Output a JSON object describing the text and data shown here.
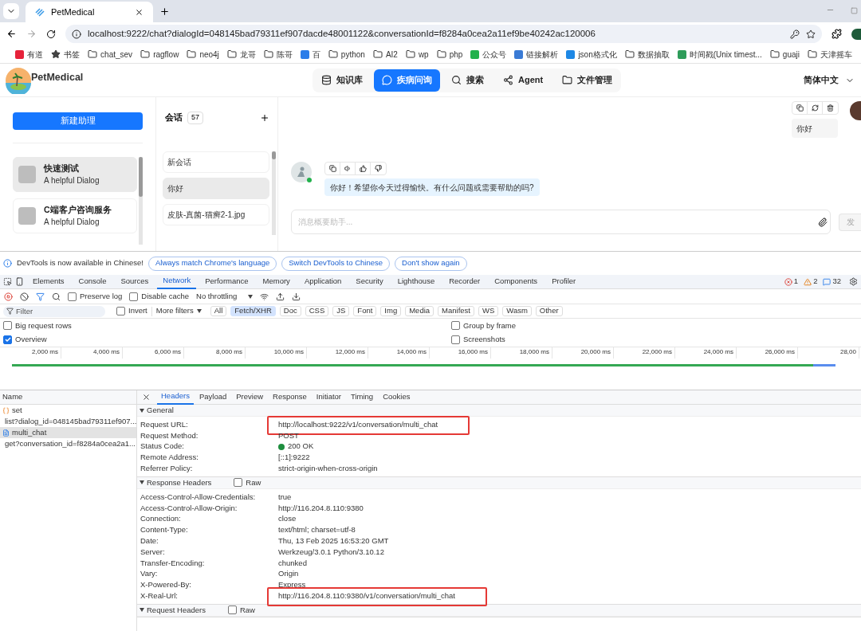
{
  "browser": {
    "tabs": [
      {
        "title": "PetMedical",
        "selected": true
      }
    ],
    "address": "localhost:9222/chat?dialogId=048145bad79311ef907dacde48001122&conversationId=f8284a0cea2a11ef9be40242ac120006",
    "bookmarks": [
      {
        "label": "有道",
        "kind": "app",
        "color": "#e6223a"
      },
      {
        "label": "书签",
        "kind": "star"
      },
      {
        "label": "chat_sev",
        "kind": "folder"
      },
      {
        "label": "ragflow",
        "kind": "folder"
      },
      {
        "label": "neo4j",
        "kind": "folder"
      },
      {
        "label": "龙哥",
        "kind": "folder"
      },
      {
        "label": "陈哥",
        "kind": "folder"
      },
      {
        "label": "百",
        "kind": "app",
        "color": "#2b7de9"
      },
      {
        "label": "python",
        "kind": "folder"
      },
      {
        "label": "AI2",
        "kind": "folder"
      },
      {
        "label": "wp",
        "kind": "folder"
      },
      {
        "label": "php",
        "kind": "folder"
      },
      {
        "label": "公众号",
        "kind": "app",
        "color": "#22b14c"
      },
      {
        "label": "链接解析",
        "kind": "app",
        "color": "#3a7bd5"
      },
      {
        "label": "json格式化",
        "kind": "app",
        "color": "#1e88e5"
      },
      {
        "label": "数据抽取",
        "kind": "folder"
      },
      {
        "label": "时间戳(Unix timest...",
        "kind": "app",
        "color": "#2e9c5a"
      },
      {
        "label": "guaji",
        "kind": "folder"
      },
      {
        "label": "天津摇车",
        "kind": "folder"
      }
    ]
  },
  "app": {
    "brand": "PetMedical",
    "nav": [
      {
        "label": "知识库",
        "kind": "database",
        "selected": false
      },
      {
        "label": "疾病问询",
        "kind": "chat",
        "selected": true
      },
      {
        "label": "搜索",
        "kind": "search",
        "selected": false
      },
      {
        "label": "Agent",
        "kind": "graph",
        "selected": false
      },
      {
        "label": "文件管理",
        "kind": "folder",
        "selected": false
      }
    ],
    "language": "简体中文",
    "new_assistant": "新建助理",
    "assistants": [
      {
        "name": "快速测试",
        "description": "A helpful Dialog",
        "selected": true
      },
      {
        "name": "C端客户咨询服务",
        "description": "A helpful Dialog",
        "selected": false
      }
    ],
    "conversations": {
      "title": "会话",
      "count": "57",
      "items": [
        {
          "title": "新会话",
          "selected": false
        },
        {
          "title": "你好",
          "selected": true
        },
        {
          "title": "皮肤-真菌-猫癣2-1.jpg",
          "selected": false
        }
      ]
    },
    "messages": [
      {
        "kind": "user",
        "text": "你好"
      },
      {
        "kind": "assistant",
        "text": "你好！希望你今天过得愉快。有什么问题或需要帮助的吗?"
      }
    ],
    "input_placeholder": "消息概要助手...",
    "send": "发"
  },
  "devtools": {
    "notice": "DevTools is now available in Chinese!",
    "notice_buttons": [
      "Always match Chrome's language",
      "Switch DevTools to Chinese",
      "Don't show again"
    ],
    "panels": [
      {
        "label": "Elements",
        "selected": false
      },
      {
        "label": "Console",
        "selected": false
      },
      {
        "label": "Sources",
        "selected": false
      },
      {
        "label": "Network",
        "selected": true
      },
      {
        "label": "Performance",
        "selected": false
      },
      {
        "label": "Memory",
        "selected": false
      },
      {
        "label": "Application",
        "selected": false
      },
      {
        "label": "Security",
        "selected": false
      },
      {
        "label": "Lighthouse",
        "selected": false
      },
      {
        "label": "Recorder",
        "selected": false
      },
      {
        "label": "Components",
        "selected": false
      },
      {
        "label": "Profiler",
        "selected": false
      }
    ],
    "errors": "1",
    "warnings": "2",
    "messages": "32",
    "preserve_log": {
      "label": "Preserve log",
      "checked": false
    },
    "disable_cache": {
      "label": "Disable cache",
      "checked": false
    },
    "throttling": "No throttling",
    "filter_placeholder": "Filter",
    "invert": {
      "label": "Invert",
      "checked": false
    },
    "more_filters": "More filters",
    "types": [
      {
        "label": "All",
        "selected": false
      },
      {
        "label": "Fetch/XHR",
        "selected": true
      },
      {
        "label": "Doc",
        "selected": false
      },
      {
        "label": "CSS",
        "selected": false
      },
      {
        "label": "JS",
        "selected": false
      },
      {
        "label": "Font",
        "selected": false
      },
      {
        "label": "Img",
        "selected": false
      },
      {
        "label": "Media",
        "selected": false
      },
      {
        "label": "Manifest",
        "selected": false
      },
      {
        "label": "WS",
        "selected": false
      },
      {
        "label": "Wasm",
        "selected": false
      },
      {
        "label": "Other",
        "selected": false
      }
    ],
    "options_left": [
      {
        "label": "Big request rows",
        "checked": false
      },
      {
        "label": "Overview",
        "checked": true
      }
    ],
    "options_right": [
      {
        "label": "Group by frame",
        "checked": false
      },
      {
        "label": "Screenshots",
        "checked": false
      }
    ],
    "ticks": [
      "2,000 ms",
      "4,000 ms",
      "6,000 ms",
      "8,000 ms",
      "10,000 ms",
      "12,000 ms",
      "14,000 ms",
      "16,000 ms",
      "18,000 ms",
      "20,000 ms",
      "22,000 ms",
      "24,000 ms",
      "26,000 ms",
      "28,00"
    ],
    "name_header": "Name",
    "requests": [
      {
        "name": "set",
        "kind": "xhr",
        "selected": false
      },
      {
        "name": "list?dialog_id=048145bad79311ef907...",
        "kind": "xhr",
        "selected": false
      },
      {
        "name": "multi_chat",
        "kind": "doc",
        "selected": true
      },
      {
        "name": "get?conversation_id=f8284a0cea2a1...",
        "kind": "xhr",
        "selected": false
      }
    ],
    "detail_tabs": [
      {
        "label": "Headers",
        "selected": true
      },
      {
        "label": "Payload",
        "selected": false
      },
      {
        "label": "Preview",
        "selected": false
      },
      {
        "label": "Response",
        "selected": false
      },
      {
        "label": "Initiator",
        "selected": false
      },
      {
        "label": "Timing",
        "selected": false
      },
      {
        "label": "Cookies",
        "selected": false
      }
    ],
    "sections": [
      {
        "title": "General",
        "rows": [
          {
            "name": "Request URL:",
            "value": "http://localhost:9222/v1/conversation/multi_chat",
            "highlighted": true
          },
          {
            "name": "Request Method:",
            "value": "POST",
            "highlighted": false
          },
          {
            "name": "Status Code:",
            "value": "200 OK",
            "highlighted": false,
            "color": "#1e8e3e"
          },
          {
            "name": "Remote Address:",
            "value": "[::1]:9222",
            "highlighted": false
          },
          {
            "name": "Referrer Policy:",
            "value": "strict-origin-when-cross-origin",
            "highlighted": false
          }
        ]
      },
      {
        "title": "Response Headers",
        "raw": {
          "label": "Raw",
          "checked": false
        },
        "rows": [
          {
            "name": "Access-Control-Allow-Credentials:",
            "value": "true",
            "highlighted": false
          },
          {
            "name": "Access-Control-Allow-Origin:",
            "value": "http://116.204.8.110:9380",
            "highlighted": false
          },
          {
            "name": "Connection:",
            "value": "close",
            "highlighted": false
          },
          {
            "name": "Content-Type:",
            "value": "text/html; charset=utf-8",
            "highlighted": false
          },
          {
            "name": "Date:",
            "value": "Thu, 13 Feb 2025 16:53:20 GMT",
            "highlighted": false
          },
          {
            "name": "Server:",
            "value": "Werkzeug/3.0.1 Python/3.10.12",
            "highlighted": false
          },
          {
            "name": "Transfer-Encoding:",
            "value": "chunked",
            "highlighted": false
          },
          {
            "name": "Vary:",
            "value": "Origin",
            "highlighted": false
          },
          {
            "name": "X-Powered-By:",
            "value": "Express",
            "highlighted": false
          },
          {
            "name": "X-Real-Url:",
            "value": "http://116.204.8.110:9380/v1/conversation/multi_chat",
            "highlighted": true
          }
        ]
      },
      {
        "title": "Request Headers",
        "raw": {
          "label": "Raw",
          "checked": false
        }
      }
    ]
  }
}
